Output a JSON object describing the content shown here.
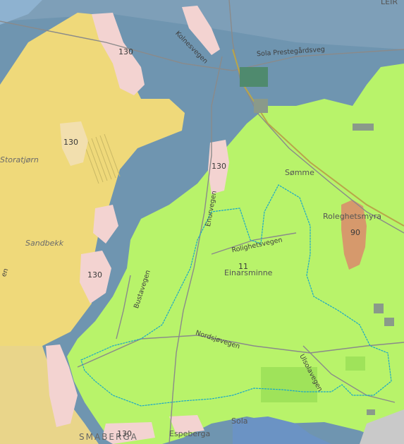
{
  "map": {
    "zones": {
      "zone_130_color": "#f7e07a",
      "zone_green_color": "#b9f56a",
      "zone_90_color": "#d79a70",
      "zone_pink_color": "#f5d6d4",
      "water_color": "#7ea9cf"
    },
    "place_names": {
      "storatjorn": "Storatjørn",
      "sandbekk": "Sandbekk",
      "somme": "Sømme",
      "roleghetsmyra": "Roleghetsmyra",
      "einarsminne": "Einarsminne",
      "smaberga": "SMABERGA",
      "espeberga": "Espeberga",
      "sola": "Sola",
      "top_partial": "LEIR"
    },
    "road_names": {
      "kolnesvegen": "Kolnesvegen",
      "sola_prestegardsveg": "Sola Prestegårdsveg",
      "enurvegen": "Enurvegen",
      "rolighetsvegen": "Rolighetsvegen",
      "bustavegen": "Bustavegen",
      "nordsjovegen": "Nordsjøvegen",
      "ulsolavegen": "Ulsolavegen",
      "left_partial": "en"
    },
    "zone_values": {
      "z130_a": "130",
      "z130_b": "130",
      "z130_c": "130",
      "z130_d": "130",
      "z130_e": "130",
      "z90": "90",
      "z11": "11"
    }
  }
}
